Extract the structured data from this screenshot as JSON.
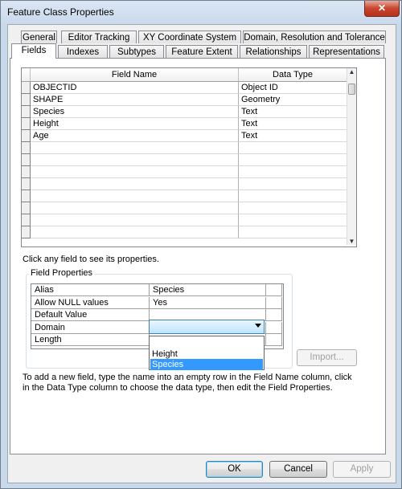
{
  "window": {
    "title": "Feature Class Properties",
    "close_glyph": "✕"
  },
  "tabs_back": [
    "General",
    "Editor Tracking",
    "XY Coordinate System",
    "Domain, Resolution and Tolerance"
  ],
  "tabs_front": [
    "Fields",
    "Indexes",
    "Subtypes",
    "Feature Extent",
    "Relationships",
    "Representations"
  ],
  "active_tab": "Fields",
  "fields_grid": {
    "columns": [
      "Field Name",
      "Data Type"
    ],
    "rows": [
      [
        "OBJECTID",
        "Object ID"
      ],
      [
        "SHAPE",
        "Geometry"
      ],
      [
        "Species",
        "Text"
      ],
      [
        "Height",
        "Text"
      ],
      [
        "Age",
        "Text"
      ]
    ],
    "empty_rows": 8
  },
  "hint_text": "Click any field to see its properties.",
  "field_properties": {
    "group_label": "Field Properties",
    "rows": [
      [
        "Alias",
        "Species"
      ],
      [
        "Allow NULL values",
        "Yes"
      ],
      [
        "Default Value",
        ""
      ],
      [
        "Domain",
        ""
      ],
      [
        "Length",
        ""
      ]
    ]
  },
  "domain_dropdown": {
    "selected": "",
    "options": [
      "Height",
      "Species"
    ],
    "highlighted": "Species"
  },
  "import_button": "Import...",
  "help_text": "To add a new field, type the name into an empty row in the Field Name column, click in the Data Type column to choose the data type, then edit the Field Properties.",
  "buttons": {
    "ok": "OK",
    "cancel": "Cancel",
    "apply": "Apply"
  }
}
